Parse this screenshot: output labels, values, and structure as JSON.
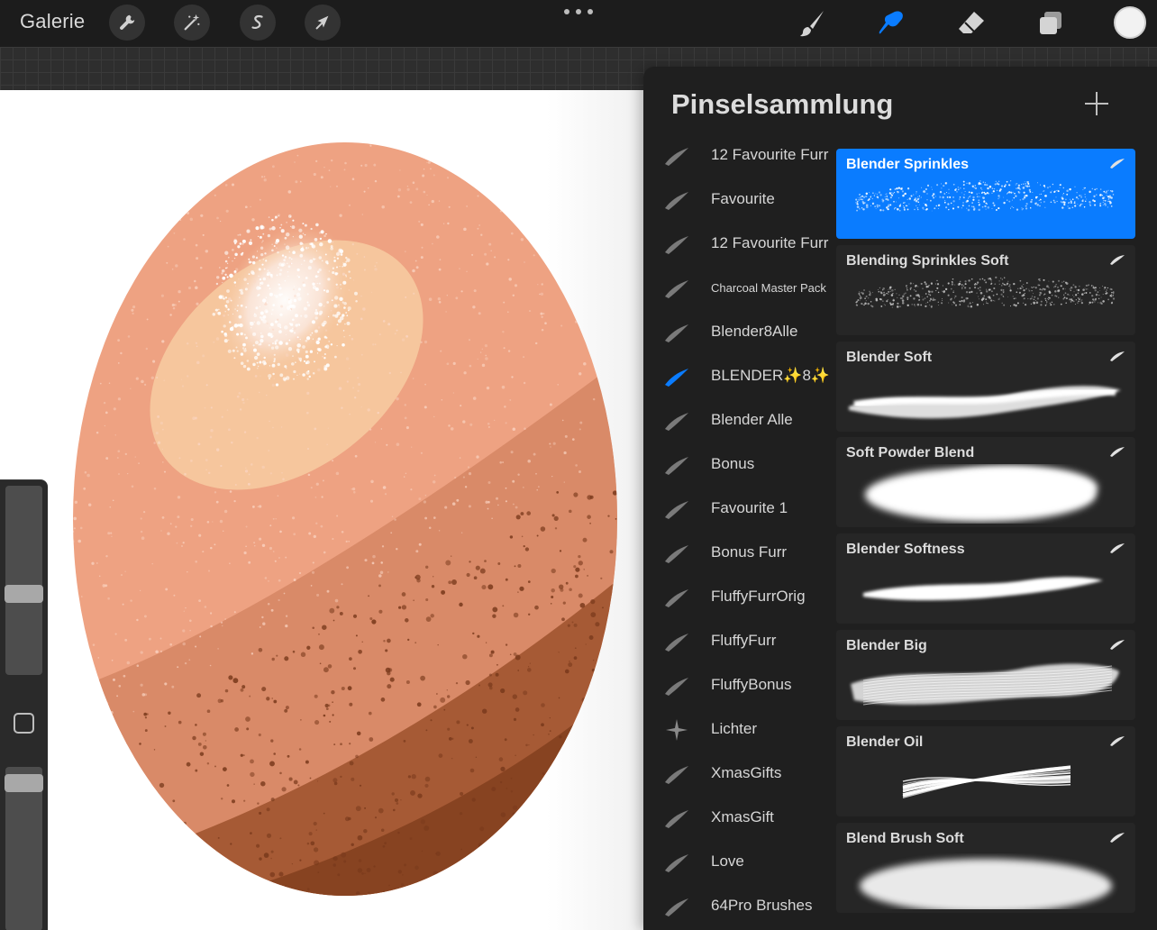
{
  "toolbar": {
    "gallery_label": "Galerie",
    "left_tools": [
      "wrench-icon",
      "magic-wand-icon",
      "selection-icon",
      "transform-arrow-icon"
    ],
    "right_tools": [
      "paintbrush-icon",
      "smudge-icon",
      "eraser-icon",
      "layers-icon"
    ],
    "active_tool": "smudge-icon",
    "current_color": "#f2f2f2"
  },
  "colors": {
    "accent": "#0a7cff",
    "egg_base": "#eea282",
    "egg_mid": "#d98a68",
    "egg_dark": "#a65a35",
    "egg_darkest": "#874321",
    "egg_highlight": "#f6c69d"
  },
  "panel": {
    "title": "Pinselsammlung",
    "add_icon": "plus-icon",
    "brush_sets": [
      {
        "label": "12 Favourite Furr",
        "icon": "brush-stroke-icon",
        "active": false
      },
      {
        "label": "Favourite",
        "icon": "brush-stroke-icon",
        "active": false
      },
      {
        "label": "12 Favourite Furr",
        "icon": "brush-stroke-icon",
        "active": false
      },
      {
        "label": "Charcoal Master Pack",
        "icon": "brush-stroke-icon",
        "active": false
      },
      {
        "label": "Blender8Alle",
        "icon": "brush-stroke-icon",
        "active": false
      },
      {
        "label": "BLENDER✨8✨",
        "icon": "brush-stroke-icon",
        "active": true
      },
      {
        "label": "Blender Alle",
        "icon": "brush-stroke-icon",
        "active": false
      },
      {
        "label": "Bonus",
        "icon": "brush-stroke-icon",
        "active": false
      },
      {
        "label": "Favourite  1",
        "icon": "brush-stroke-icon",
        "active": false
      },
      {
        "label": "Bonus Furr",
        "icon": "brush-stroke-icon",
        "active": false
      },
      {
        "label": "FluffyFurrOrig",
        "icon": "brush-stroke-icon",
        "active": false
      },
      {
        "label": "FluffyFurr",
        "icon": "brush-stroke-icon",
        "active": false
      },
      {
        "label": "FluffyBonus",
        "icon": "brush-stroke-icon",
        "active": false
      },
      {
        "label": "Lichter",
        "icon": "sparkle-icon",
        "active": false
      },
      {
        "label": "XmasGifts",
        "icon": "brush-stroke-icon",
        "active": false
      },
      {
        "label": "XmasGift",
        "icon": "brush-stroke-icon",
        "active": false
      },
      {
        "label": "Love",
        "icon": "brush-stroke-icon",
        "active": false
      },
      {
        "label": "64Pro Brushes",
        "icon": "brush-stroke-icon",
        "active": false
      }
    ],
    "brushes": [
      {
        "name": "Blender Sprinkles",
        "stroke": "sprinkles",
        "selected": true
      },
      {
        "name": "Blending Sprinkles Soft",
        "stroke": "sprinkles-soft",
        "selected": false
      },
      {
        "name": "Blender Soft",
        "stroke": "soft-wave",
        "selected": false
      },
      {
        "name": "Soft Powder Blend",
        "stroke": "powder",
        "selected": false
      },
      {
        "name": "Blender Softness",
        "stroke": "thin-wave",
        "selected": false
      },
      {
        "name": "Blender Big",
        "stroke": "big-streak",
        "selected": false
      },
      {
        "name": "Blender Oil",
        "stroke": "oil-streak",
        "selected": false
      },
      {
        "name": "Blend Brush Soft",
        "stroke": "soft-blob",
        "selected": false
      }
    ]
  },
  "sidebar": {
    "brush_size_level": 0.42,
    "opacity_level": 0.95,
    "modify_icon": "square-icon"
  }
}
